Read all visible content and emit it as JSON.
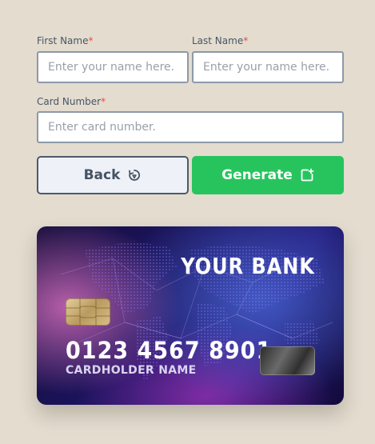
{
  "form": {
    "first_name": {
      "label": "First Name",
      "required_mark": "*",
      "placeholder": "Enter your name here.",
      "value": ""
    },
    "last_name": {
      "label": "Last Name",
      "required_mark": "*",
      "placeholder": "Enter your name here.",
      "value": ""
    },
    "card_number": {
      "label": "Card Number",
      "required_mark": "*",
      "placeholder": "Enter card number.",
      "value": ""
    }
  },
  "buttons": {
    "back_label": "Back",
    "back_icon": "rotate-arrow-icon",
    "generate_label": "Generate",
    "generate_icon": "square-plus-icon"
  },
  "card": {
    "bank_name": "YOUR BANK",
    "number": "0123 4567 8901",
    "holder": "CARDHOLDER NAME"
  },
  "colors": {
    "background": "#e3dccf",
    "generate": "#27c45e",
    "required": "#e84a4a"
  }
}
